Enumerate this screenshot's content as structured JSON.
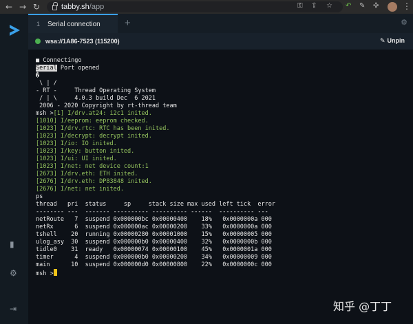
{
  "browser": {
    "url_host": "tabby.sh",
    "url_path": "/app"
  },
  "tab": {
    "number": "1",
    "title": "Serial connection"
  },
  "connection": {
    "label": "wsa://1A86-7523 (115200)",
    "unpin_label": "Unpin"
  },
  "terminal": {
    "lines": [
      {
        "text": "■ Connectingo",
        "color": "white"
      },
      {
        "text": " Port opened",
        "color": "white",
        "highlight": "Serial"
      },
      {
        "text": "�",
        "color": "white"
      },
      {
        "text": " \\ | /",
        "color": "white"
      },
      {
        "text": "- RT -     Thread Operating System",
        "color": "white"
      },
      {
        "text": " / | \\     4.0.3 build Dec  6 2021",
        "color": "white"
      },
      {
        "text": " 2006 - 2020 Copyright by rt-thread team",
        "color": "white"
      },
      {
        "text": "msh >[1] I/drv.at24: i2c1 inited.",
        "color": "mixed"
      },
      {
        "text": "[1010] I/eeprom: eeprom checked.",
        "color": "green"
      },
      {
        "text": "[1023] I/drv.rtc: RTC has been inited.",
        "color": "green"
      },
      {
        "text": "[1023] I/decrypt: decrypt inited.",
        "color": "green"
      },
      {
        "text": "[1023] I/io: IO inited.",
        "color": "green"
      },
      {
        "text": "[1023] I/key: button inited.",
        "color": "green"
      },
      {
        "text": "[1023] I/ui: UI inited.",
        "color": "green"
      },
      {
        "text": "[1023] I/net: net device count:1",
        "color": "green"
      },
      {
        "text": "[2673] I/drv.eth: ETH inited.",
        "color": "green"
      },
      {
        "text": "[2676] I/drv.eth: DP83848 inited.",
        "color": "green"
      },
      {
        "text": "[2676] I/net: net inited.",
        "color": "green"
      },
      {
        "text": "ps",
        "color": "white"
      },
      {
        "text": "thread   pri  status     sp     stack size max used left tick  error",
        "color": "white"
      },
      {
        "text": "-------- ---  ------- ---------- ---------- ------  ---------- ---",
        "color": "white"
      },
      {
        "text": "netRoute   7  suspend 0x000000bc 0x00000400    18%   0x0000000a 000",
        "color": "white"
      },
      {
        "text": "netRx      6  suspend 0x000000ac 0x00000200    33%   0x0000000a 000",
        "color": "white"
      },
      {
        "text": "tshell    20  running 0x00000280 0x00001000    15%   0x00000005 000",
        "color": "white"
      },
      {
        "text": "ulog_asy  30  suspend 0x000000b0 0x00000400    32%   0x0000000b 000",
        "color": "white"
      },
      {
        "text": "tidle0    31  ready   0x00000074 0x00000100    45%   0x0000001a 000",
        "color": "white"
      },
      {
        "text": "timer      4  suspend 0x000000b0 0x00000200    34%   0x00000009 000",
        "color": "white"
      },
      {
        "text": "main      10  suspend 0x000000d0 0x00000800    22%   0x0000000c 000",
        "color": "white"
      },
      {
        "text": "msh >",
        "color": "white",
        "cursor": true
      }
    ]
  },
  "watermark": "知乎 @丁丁",
  "colors": {
    "accent": "#3aa0e8",
    "connected": "#4caf50",
    "log_green": "#95c45e",
    "cursor": "#f0c419"
  }
}
